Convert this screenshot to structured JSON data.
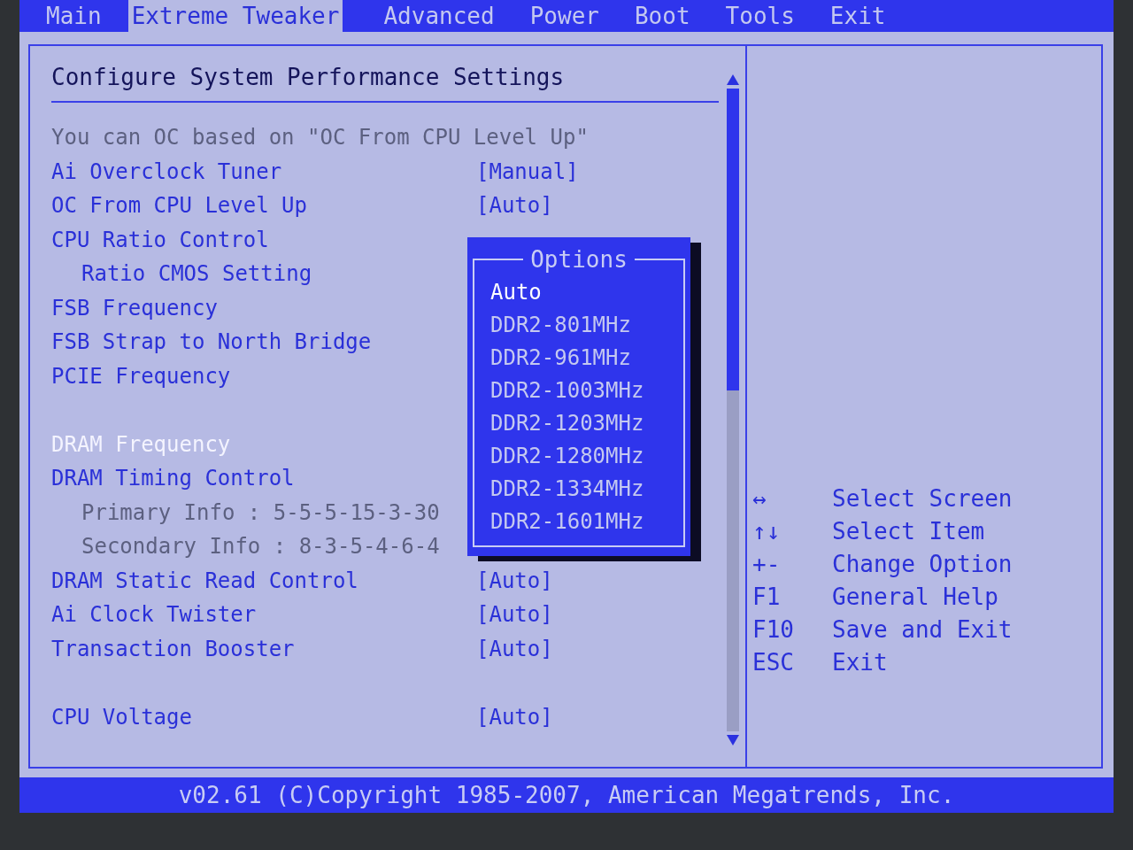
{
  "menu_bar": {
    "tabs": [
      {
        "label": "Main",
        "selected": false
      },
      {
        "label": "Extreme Tweaker",
        "selected": true
      },
      {
        "label": "Advanced",
        "selected": false
      },
      {
        "label": "Power",
        "selected": false
      },
      {
        "label": "Boot",
        "selected": false
      },
      {
        "label": "Tools",
        "selected": false
      },
      {
        "label": "Exit",
        "selected": false
      }
    ]
  },
  "settings_panel": {
    "title": "Configure System Performance Settings",
    "rows": [
      {
        "kind": "info",
        "label": "You can OC based on \"OC From CPU Level Up\""
      },
      {
        "kind": "setting",
        "label": "Ai Overclock Tuner",
        "value": "[Manual]",
        "selected": false
      },
      {
        "kind": "setting",
        "label": "OC From CPU Level Up",
        "value": "[Auto]",
        "selected": false
      },
      {
        "kind": "setting",
        "label": "CPU Ratio Control",
        "selected": false
      },
      {
        "kind": "sub",
        "label": "Ratio CMOS Setting",
        "selected": false
      },
      {
        "kind": "setting",
        "label": "FSB Frequency",
        "selected": false
      },
      {
        "kind": "setting",
        "label": "FSB Strap to North Bridge",
        "selected": false
      },
      {
        "kind": "setting",
        "label": "PCIE Frequency",
        "selected": false
      },
      {
        "kind": "gap"
      },
      {
        "kind": "setting",
        "label": "DRAM Frequency",
        "selected": true
      },
      {
        "kind": "setting",
        "label": "DRAM Timing Control",
        "selected": false
      },
      {
        "kind": "subinfo",
        "label": "Primary Info : 5-5-5-15-3-30"
      },
      {
        "kind": "subinfo",
        "label": "Secondary Info : 8-3-5-4-6-4"
      },
      {
        "kind": "setting",
        "label": "DRAM Static Read Control",
        "value": "[Auto]",
        "selected": false
      },
      {
        "kind": "setting",
        "label": "Ai Clock Twister",
        "value": "[Auto]",
        "selected": false
      },
      {
        "kind": "setting",
        "label": "Transaction Booster",
        "value": "[Auto]",
        "selected": false
      },
      {
        "kind": "gap"
      },
      {
        "kind": "setting",
        "label": "CPU Voltage",
        "value": "[Auto]",
        "selected": false
      }
    ]
  },
  "options_popup": {
    "title": "Options",
    "items": [
      {
        "label": "Auto",
        "selected": true
      },
      {
        "label": "DDR2-801MHz",
        "selected": false
      },
      {
        "label": "DDR2-961MHz",
        "selected": false
      },
      {
        "label": "DDR2-1003MHz",
        "selected": false
      },
      {
        "label": "DDR2-1203MHz",
        "selected": false
      },
      {
        "label": "DDR2-1280MHz",
        "selected": false
      },
      {
        "label": "DDR2-1334MHz",
        "selected": false
      },
      {
        "label": "DDR2-1601MHz",
        "selected": false
      }
    ]
  },
  "help_panel": {
    "keys": [
      {
        "key": "↔",
        "action": "Select Screen"
      },
      {
        "key": "↑↓",
        "action": "Select Item"
      },
      {
        "key": "+-",
        "action": "Change Option"
      },
      {
        "key": "F1",
        "action": "General Help"
      },
      {
        "key": "F10",
        "action": "Save and Exit"
      },
      {
        "key": "ESC",
        "action": "Exit"
      }
    ]
  },
  "status_bar": {
    "text": "v02.61 (C)Copyright 1985-2007, American Megatrends, Inc."
  }
}
